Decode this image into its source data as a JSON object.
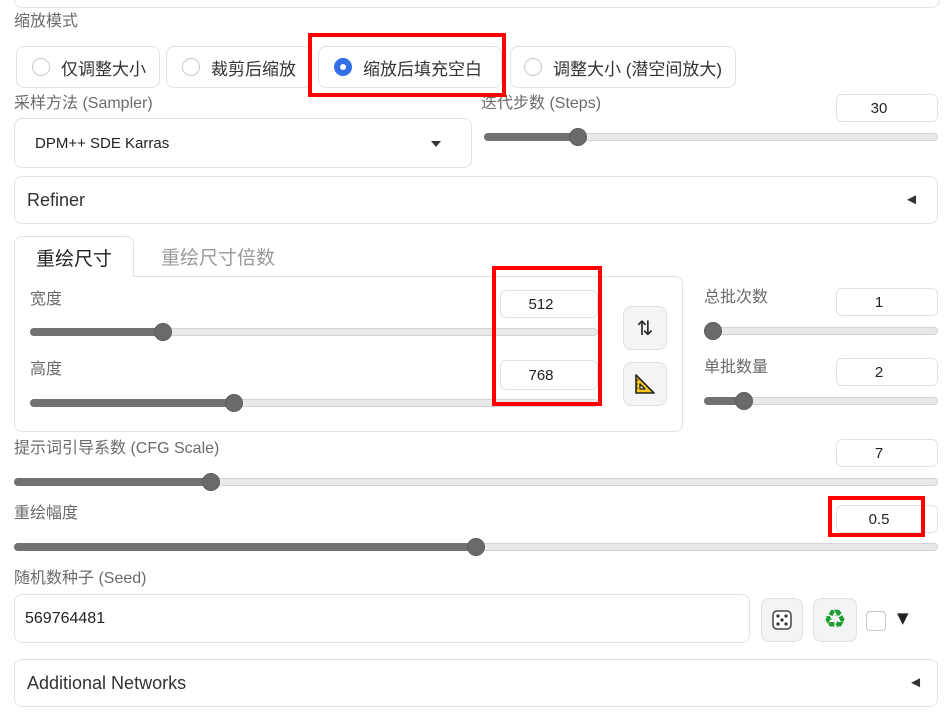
{
  "colors": {
    "accent": "#3370e8",
    "highlight": "#ff0000",
    "slider_fill": "#717171",
    "slider_track": "#e9e9e9",
    "border": "#e2e2e2"
  },
  "resize_mode": {
    "label": "缩放模式",
    "options": [
      {
        "label": "仅调整大小",
        "checked": false
      },
      {
        "label": "裁剪后缩放",
        "checked": false
      },
      {
        "label": "缩放后填充空白",
        "checked": true
      },
      {
        "label": "调整大小 (潜空间放大)",
        "checked": false
      }
    ]
  },
  "sampler": {
    "label": "采样方法 (Sampler)",
    "value": "DPM++ SDE Karras",
    "icon": "caret-down-icon"
  },
  "steps": {
    "label": "迭代步数 (Steps)",
    "value": "30",
    "level": 0.195
  },
  "refiner": {
    "label": "Refiner",
    "toggle_glyph": "◄"
  },
  "size_tabs": [
    {
      "label": "重绘尺寸",
      "active": true
    },
    {
      "label": "重绘尺寸倍数",
      "active": false
    }
  ],
  "width": {
    "label": "宽度",
    "value": "512",
    "level": 0.226
  },
  "height": {
    "label": "高度",
    "value": "768",
    "level": 0.355
  },
  "swap_button": {
    "glyph": "⇅",
    "icon": "swap-dimensions-icon"
  },
  "aspect_button": {
    "icon": "triangle-ruler-icon"
  },
  "batch_count": {
    "label": "总批次数",
    "value": "1",
    "level": 0
  },
  "batch_size": {
    "label": "单批数量",
    "value": "2",
    "level": 0.143
  },
  "cfg_scale": {
    "label": "提示词引导系数 (CFG Scale)",
    "value": "7",
    "level": 0.207
  },
  "denoising": {
    "label": "重绘幅度",
    "value": "0.5",
    "level": 0.5
  },
  "seed": {
    "label": "随机数种子 (Seed)",
    "value": "569764481",
    "random_icon": "dice-icon",
    "reuse_glyph": "♻",
    "reuse_icon": "recycle-icon",
    "extra_checked": false,
    "extra_glyph": "▼"
  },
  "additional_networks": {
    "label": "Additional Networks",
    "toggle_glyph": "◄"
  }
}
